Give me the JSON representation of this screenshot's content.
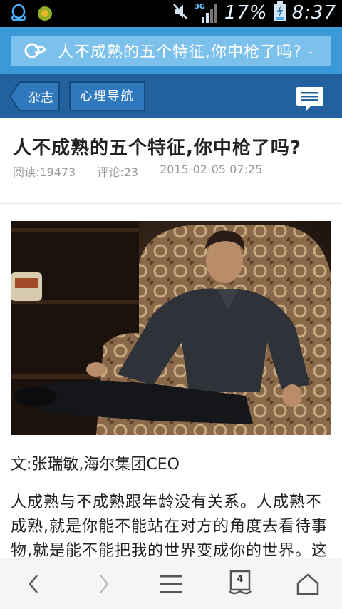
{
  "status_bar": {
    "network": "3G",
    "battery": "17%",
    "time": "8:37"
  },
  "url_bar": {
    "text": "人不成熟的五个特征,你中枪了吗? -"
  },
  "site_nav": {
    "back_label": "杂志",
    "category_label": "心理导航"
  },
  "article": {
    "title": "人不成熟的五个特征,你中枪了吗?",
    "views": "阅读:19473",
    "comments": "评论:23",
    "date": "2015-02-05 07:25",
    "byline": "文:张瑞敏,海尔集团CEO",
    "body": "人成熟与不成熟跟年龄没有关系。人成熟不成熟,就是你能不能站在对方的角度去看待事物,就是能不能把我的世界变成你的世界。这个"
  },
  "bottom_bar": {
    "tab_count": "4"
  }
}
